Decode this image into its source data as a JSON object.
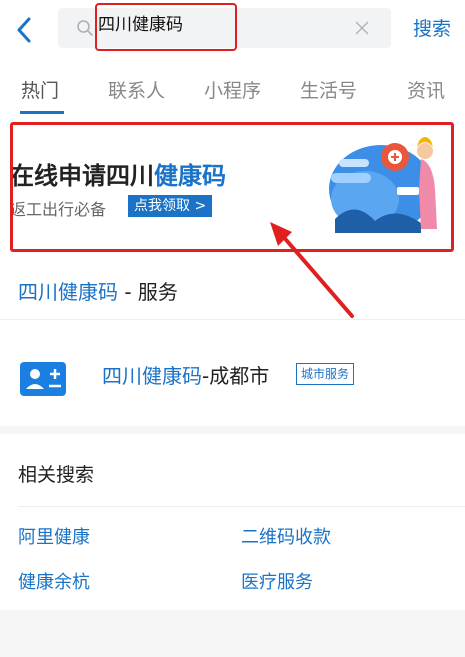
{
  "search": {
    "query": "四川健康码",
    "submit_label": "搜索"
  },
  "tabs": [
    {
      "label": "热门"
    },
    {
      "label": "联系人"
    },
    {
      "label": "小程序"
    },
    {
      "label": "生活号"
    },
    {
      "label": "资讯"
    }
  ],
  "banner": {
    "title_prefix": "在线申请四川",
    "title_highlight": "健康码",
    "subtitle": "返工出行必备",
    "cta_label": "点我领取 >"
  },
  "service": {
    "heading_highlight": "四川健康码",
    "heading_rest": " - 服务",
    "city": {
      "name_highlight": "四川健康码",
      "name_rest": "-成都市",
      "tag": "城市服务"
    }
  },
  "related": {
    "heading": "相关搜索",
    "links": [
      "阿里健康",
      "二维码收款",
      "健康余杭",
      "医疗服务"
    ]
  },
  "colors": {
    "accent": "#1a73c7",
    "annotation_red": "#e02020"
  }
}
